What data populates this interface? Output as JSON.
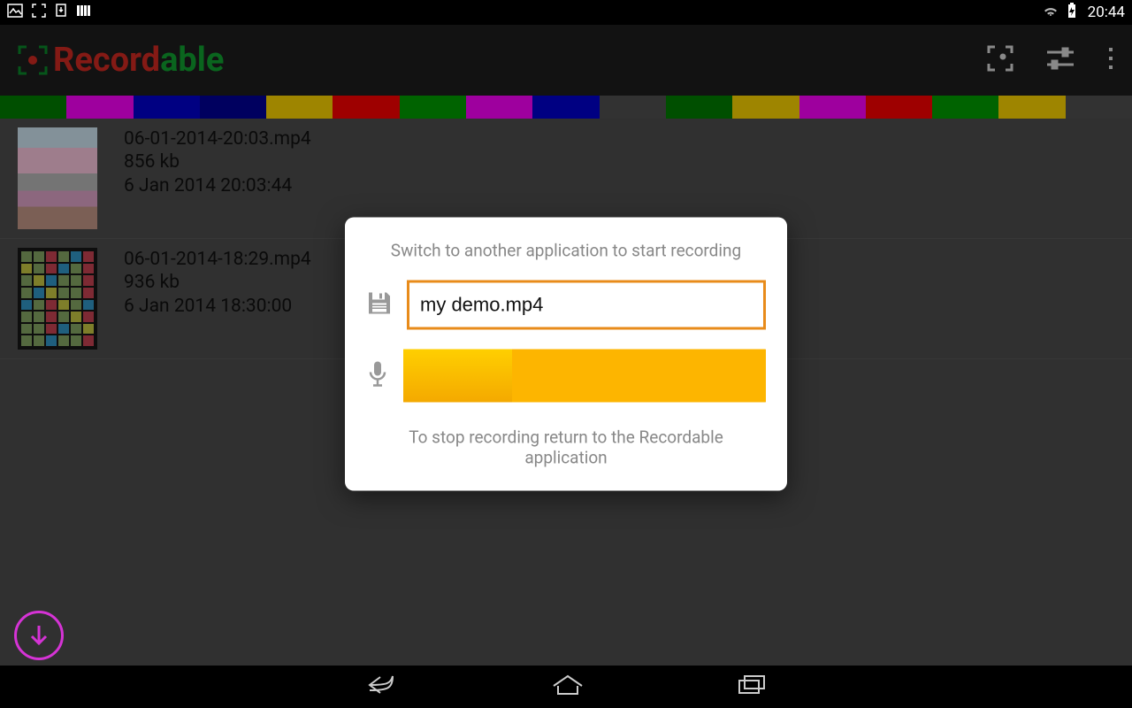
{
  "statusbar": {
    "time": "20:44"
  },
  "appbar": {
    "logo_part1": "Record",
    "logo_part2": "able"
  },
  "colorstrip": [
    "#008000",
    "#ff00ff",
    "#0000d2",
    "#000099",
    "#ffd700",
    "#ff0000",
    "#00a000",
    "#ff00ff",
    "#0000d2",
    "#525252",
    "#008000",
    "#ffd700",
    "#ff00ff",
    "#ff0000",
    "#00a000",
    "#ffd700",
    "#525252"
  ],
  "recordings": [
    {
      "filename": "06-01-2014-20:03.mp4",
      "size": "856 kb",
      "date": "6 Jan 2014 20:03:44"
    },
    {
      "filename": "06-01-2014-18:29.mp4",
      "size": "936 kb",
      "date": "6 Jan 2014 18:30:00"
    }
  ],
  "dialog": {
    "title": "Switch to another application to start recording",
    "filename": "my demo.mp4",
    "audio_level_percent": 30,
    "footer": "To stop recording return to the Recordable application"
  }
}
